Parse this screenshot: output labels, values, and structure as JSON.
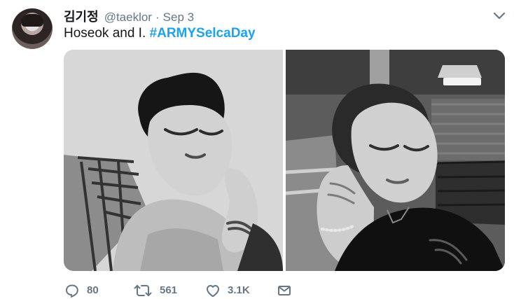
{
  "tweet": {
    "author": {
      "display_name": "김기정",
      "handle": "@taeklor",
      "separator": "·",
      "date": "Sep 3"
    },
    "text": "Hoseok and I. ",
    "hashtag": "#ARMYSelcaDay",
    "media": [
      {
        "kind": "photo",
        "tone": "grayscale"
      },
      {
        "kind": "photo",
        "tone": "grayscale"
      }
    ]
  },
  "actions": {
    "reply": {
      "icon": "reply-icon",
      "count": "80"
    },
    "retweet": {
      "icon": "retweet-icon",
      "count": "561"
    },
    "like": {
      "icon": "heart-icon",
      "count": "3.1K"
    },
    "dm": {
      "icon": "mail-icon"
    }
  },
  "colors": {
    "text": "#14171a",
    "muted": "#657786",
    "accent": "#1da1f2",
    "background": "#ffffff"
  }
}
